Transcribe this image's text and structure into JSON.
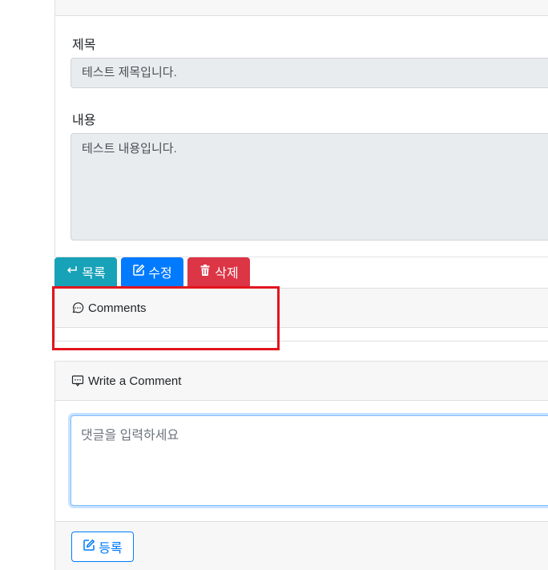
{
  "post": {
    "title_label": "제목",
    "title_value": "테스트 제목입니다.",
    "content_label": "내용",
    "content_value": "테스트 내용입니다."
  },
  "actions": {
    "list_label": "목록",
    "edit_label": "수정",
    "delete_label": "삭제"
  },
  "comments": {
    "header": "Comments"
  },
  "write_comment": {
    "header": "Write a Comment",
    "placeholder": "댓글을 입력하세요",
    "submit_label": "등록"
  },
  "colors": {
    "list_button": "#17a2b8",
    "edit_button": "#007bff",
    "delete_button": "#dc3545",
    "highlight": "#e3141e"
  },
  "icons": {
    "list": "return-arrow-icon",
    "edit": "edit-square-icon",
    "delete": "trash-icon",
    "comments": "chat-dots-icon",
    "write": "chat-square-dots-icon",
    "submit": "edit-square-icon"
  }
}
